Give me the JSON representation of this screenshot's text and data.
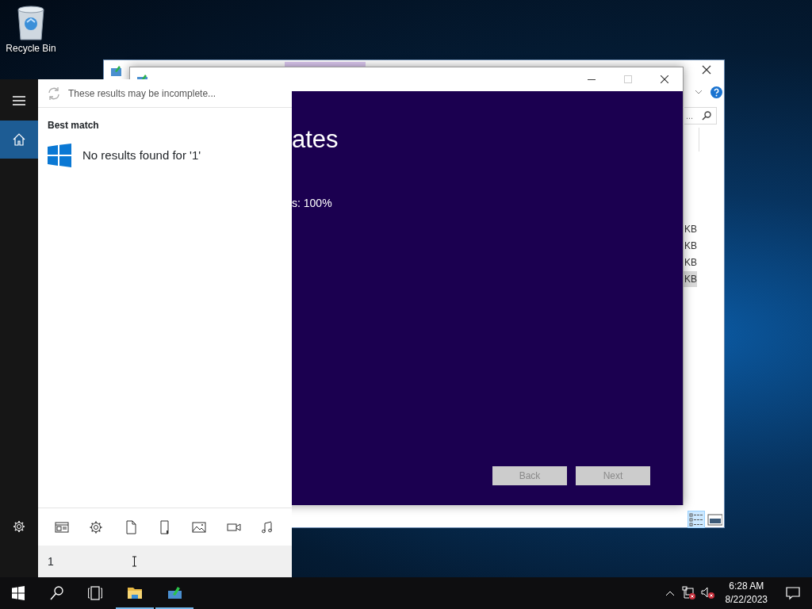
{
  "desktop": {
    "icons": [
      {
        "label": "Recycle Bin"
      }
    ]
  },
  "explorer_window": {
    "search_placeholder": "...",
    "file_rows": [
      {
        "size": "KB",
        "selected": false
      },
      {
        "size": "KB",
        "selected": false
      },
      {
        "size": "KB",
        "selected": false
      },
      {
        "size": "KB",
        "selected": true
      }
    ],
    "view_buttons": [
      {
        "kind": "details",
        "selected": true
      },
      {
        "kind": "preview",
        "selected": false
      }
    ]
  },
  "setup_window": {
    "heading": "ates",
    "progress_text": "s: 100%",
    "buttons": [
      {
        "label": "Back",
        "disabled": true
      },
      {
        "label": "Next",
        "disabled": true
      }
    ]
  },
  "start_menu": {
    "rail_items": [
      {
        "kind": "menu",
        "selected": false
      },
      {
        "kind": "home",
        "selected": true
      },
      {
        "kind": "settings",
        "selected": false
      }
    ],
    "notice": "These results may be incomplete...",
    "section": "Best match",
    "result": "No results found for '1'",
    "filters": [
      {
        "kind": "apps"
      },
      {
        "kind": "settings"
      },
      {
        "kind": "documents"
      },
      {
        "kind": "folders"
      },
      {
        "kind": "photos"
      },
      {
        "kind": "videos"
      },
      {
        "kind": "music"
      }
    ],
    "search_value": "1"
  },
  "taskbar": {
    "items": [
      {
        "kind": "start",
        "running": false
      },
      {
        "kind": "search",
        "running": false
      },
      {
        "kind": "taskview",
        "running": false
      },
      {
        "kind": "explorer",
        "running": true
      },
      {
        "kind": "setup",
        "running": true
      }
    ],
    "time": "6:28 AM",
    "date": "8/22/2023"
  }
}
